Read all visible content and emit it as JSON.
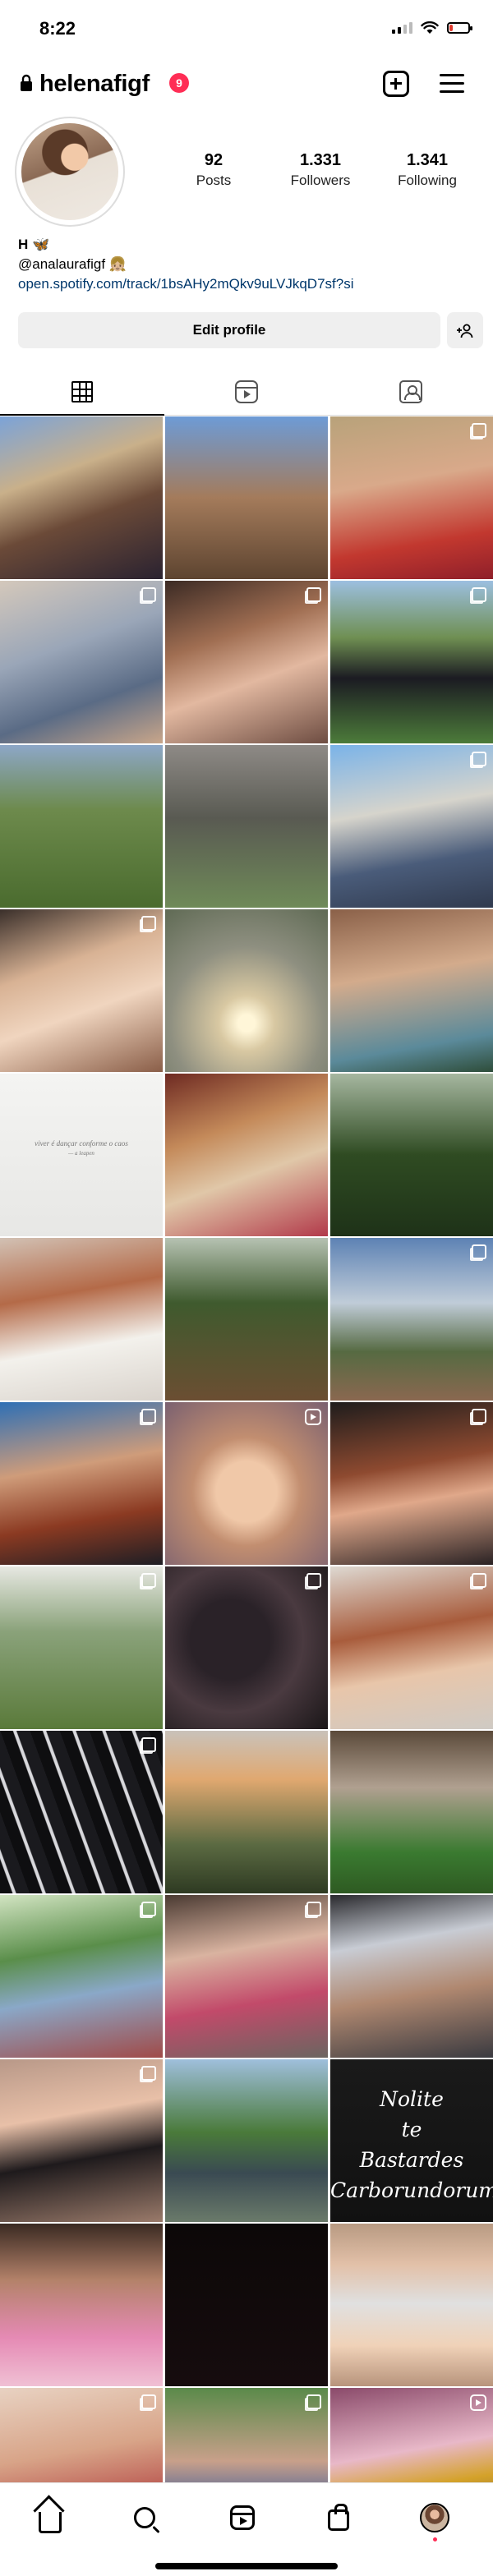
{
  "status_bar": {
    "time": "8:22",
    "battery_level": 0.2,
    "battery_color": "#e03a2e"
  },
  "header": {
    "username": "helenafigf",
    "notification_count": "9",
    "lock_icon": "lock-icon",
    "add_icon": "plus-square-icon",
    "menu_icon": "hamburger-menu-icon"
  },
  "profile": {
    "stats": [
      {
        "value": "92",
        "label": "Posts"
      },
      {
        "value": "1.331",
        "label": "Followers"
      },
      {
        "value": "1.341",
        "label": "Following"
      }
    ],
    "bio_name": "H 🦋",
    "bio_line": "@analaurafigf 👧🏼",
    "bio_link": "open.spotify.com/track/1bsAHy2mQkv9uLVJkqD7sf?si",
    "edit_profile_label": "Edit profile"
  },
  "tabs": [
    {
      "name": "grid",
      "icon": "grid-icon",
      "active": true
    },
    {
      "name": "reels",
      "icon": "reels-icon",
      "active": false
    },
    {
      "name": "tagged",
      "icon": "tagged-icon",
      "active": false
    }
  ],
  "grid_posts": [
    {
      "bg": "linear-gradient(160deg,#7ba3d8 0%,#c9b08a 35%,#6b4a38 60%,#2a2230 100%)",
      "badge": "none"
    },
    {
      "bg": "linear-gradient(180deg,#6d9bd6 0%,#a47b5b 50%,#5d4430 100%)",
      "badge": "none"
    },
    {
      "bg": "linear-gradient(170deg,#b8a27a 0%,#d9a98a 40%,#c2382f 75%,#8f1f2a 100%)",
      "badge": "multi"
    },
    {
      "bg": "linear-gradient(160deg,#d4c8bb 0%,#9aa6b8 40%,#5a6b85 70%,#c9a68a 100%)",
      "badge": "multi"
    },
    {
      "bg": "linear-gradient(160deg,#3b2a24 0%,#a06e52 35%,#e2b8a0 60%,#6e4d42 100%)",
      "badge": "multi"
    },
    {
      "bg": "linear-gradient(180deg,#9cbfe0 0%,#6f8f52 35%,#1b1b22 60%,#4c7b3a 100%)",
      "badge": "multi"
    },
    {
      "bg": "linear-gradient(180deg,#8da7c7 0%,#6d8a4c 40%,#4a6b2e 100%)",
      "badge": "none"
    },
    {
      "bg": "linear-gradient(180deg,#8e8a86 0%,#595a52 45%,#6f8a58 100%)",
      "badge": "none"
    },
    {
      "bg": "linear-gradient(170deg,#7ab3e8 0%,#d6d4cc 40%,#4a5c7a 70%,#303a4e 100%)",
      "badge": "multi"
    },
    {
      "bg": "linear-gradient(160deg,#3a2f2a 0%,#d8b294 35%,#f0d5bf 60%,#8a5e48 100%)",
      "badge": "multi"
    },
    {
      "bg": "radial-gradient(circle at 50% 70%,#fff6d8 0 6%,#d8c8a2 20%,#8e8f80 55%,#5f6a54 100%)",
      "badge": "none"
    },
    {
      "bg": "linear-gradient(170deg,#8a6048 0%,#d3ab8c 40%,#5b8a9a 80%,#2e4d3a 100%)",
      "badge": "none"
    },
    {
      "bg": "linear-gradient(180deg,#f4f4f2 0%,#e7e7e5 100%)",
      "badge": "none",
      "caption": "viver é dançar conforme o caos",
      "caption_small": "— a leapen"
    },
    {
      "bg": "linear-gradient(160deg,#6e2a22 0%,#c48a5a 35%,#e0c7a8 60%,#b23a4a 100%)",
      "badge": "none"
    },
    {
      "bg": "linear-gradient(180deg,#a6b7a0 0%,#2f4b22 50%,#1e3218 100%)",
      "badge": "none"
    },
    {
      "bg": "linear-gradient(170deg,#d2c1b4 0%,#b46a48 35%,#f3f1ec 65%,#d9d3cc 100%)",
      "badge": "none"
    },
    {
      "bg": "linear-gradient(180deg,#b6c2b2 0%,#3f5a2e 40%,#6b4e32 100%)",
      "badge": "none"
    },
    {
      "bg": "linear-gradient(180deg,#5d82b4 0%,#c0ccd8 40%,#566a42 70%,#8a6850 100%)",
      "badge": "multi"
    },
    {
      "bg": "linear-gradient(170deg,#2e6fb5 0%,#cf9c7a 40%,#8b3a22 70%,#1e1e24 100%)",
      "badge": "multi"
    },
    {
      "bg": "radial-gradient(circle at 50% 55%,#f0c8a8 0 25%,#c28e70 45%,#7a6070 100%)",
      "badge": "reel"
    },
    {
      "bg": "linear-gradient(170deg,#1e1c1c 0%,#8e4a30 40%,#e0a88a 60%,#2a2224 100%)",
      "badge": "multi"
    },
    {
      "bg": "linear-gradient(180deg,#e7e8e2 0%,#8aa27a 40%,#5a7a3a 100%)",
      "badge": "multi"
    },
    {
      "bg": "radial-gradient(circle at 40% 45%,#2a2228 0 30%,#4a3a40 55%,#1a1618 100%)",
      "badge": "multi"
    },
    {
      "bg": "linear-gradient(170deg,#ded9d2 0%,#a85c3c 40%,#e8c6aa 65%,#cfcac4 100%)",
      "badge": "multi"
    },
    {
      "bg": "repeating-linear-gradient(70deg,#0e0e10 0 14px,#d8d8dc 15px 18px,#1a1a1e 19px 34px)",
      "badge": "multi"
    },
    {
      "bg": "linear-gradient(180deg,#c9c2ba 0%,#e0a870 30%,#5b6a42 70%,#2e3a22 100%)",
      "badge": "none"
    },
    {
      "bg": "linear-gradient(180deg,#5b4a3a 0%,#b0a090 35%,#3a7a30 75%,#2e5a22 100%)",
      "badge": "none"
    },
    {
      "bg": "linear-gradient(170deg,#d2e4c2 0%,#5a8e4a 35%,#8aa8c8 60%,#a04a48 100%)",
      "badge": "multi"
    },
    {
      "bg": "linear-gradient(170deg,#4a3a32 0%,#d9b3a0 35%,#c24a6a 65%,#6b6560 100%)",
      "badge": "multi"
    },
    {
      "bg": "linear-gradient(170deg,#2a2a2e 0%,#c8ccd4 30%,#b08870 60%,#3a3a40 100%)",
      "badge": "none"
    },
    {
      "bg": "linear-gradient(170deg,#b89888 0%,#e8c0a8 35%,#1e1a1c 60%,#9a7a6a 100%)",
      "badge": "multi"
    },
    {
      "bg": "linear-gradient(180deg,#9fbfdc 0%,#4a7a3a 45%,#3a4a52 70%,#6a7a6a 100%)",
      "badge": "none"
    },
    {
      "bg": "linear-gradient(180deg,#1a1a1a 0%,#111 100%)",
      "badge": "none",
      "text_art": [
        "Nolite",
        "te",
        "Bastardes",
        "Carborundorum"
      ]
    },
    {
      "bg": "linear-gradient(180deg,#3a2a22 0%,#b4826a 35%,#e58ab4 70%,#f0c0d4 100%)",
      "badge": "none"
    },
    {
      "bg": "linear-gradient(180deg,#0c0808 0%,#160c0e 100%)",
      "badge": "none"
    },
    {
      "bg": "linear-gradient(180deg,#b89a82 0%,#e2c0a8 25%,#e0e0e0 49%,#f0d2b8 75%,#b8947c 100%)",
      "badge": "none"
    },
    {
      "bg": "linear-gradient(170deg,#e8d2c2 0%,#d8a488 40%,#b8544e 70%,#2a3a5a 100%)",
      "badge": "multi"
    },
    {
      "bg": "linear-gradient(180deg,#5a8a4a 0%,#c8a08a 45%,#3a5a9a 75%,#a05a7a 100%)",
      "badge": "multi"
    },
    {
      "bg": "linear-gradient(170deg,#8a4a6a 0%,#e8b8c8 40%,#d4a22a 60%,#4a3a3a 100%)",
      "badge": "reel"
    }
  ],
  "bottom_nav": [
    {
      "name": "home",
      "icon": "home-icon"
    },
    {
      "name": "search",
      "icon": "search-icon"
    },
    {
      "name": "reels",
      "icon": "reels-icon"
    },
    {
      "name": "shop",
      "icon": "shopping-bag-icon"
    },
    {
      "name": "profile",
      "icon": "profile-avatar-icon"
    }
  ]
}
